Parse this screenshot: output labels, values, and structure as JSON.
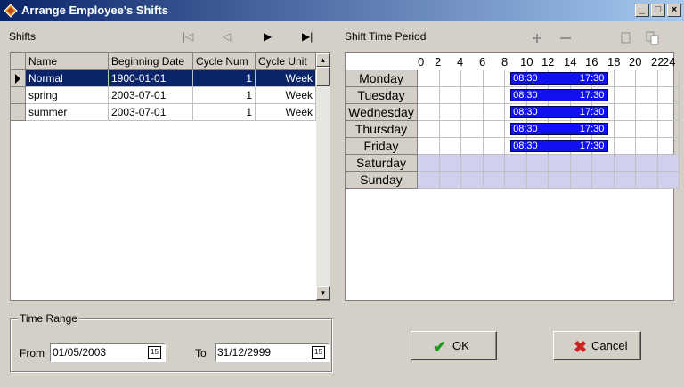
{
  "window": {
    "title": "Arrange Employee's Shifts",
    "controls": [
      "_",
      "□",
      "×"
    ]
  },
  "shifts_panel": {
    "label": "Shifts",
    "nav": [
      {
        "name": "first-record-icon",
        "glyph": "|◁"
      },
      {
        "name": "prev-record-icon",
        "glyph": "◁"
      },
      {
        "name": "next-record-icon",
        "glyph": "▶"
      },
      {
        "name": "last-record-icon",
        "glyph": "▶|"
      }
    ],
    "columns": [
      "Name",
      "Beginning Date",
      "Cycle Num",
      "Cycle Unit"
    ],
    "rows": [
      {
        "name": "Normal",
        "beginning_date": "1900-01-01",
        "cycle_num": "1",
        "cycle_unit": "Week",
        "selected": true
      },
      {
        "name": "spring",
        "beginning_date": "2003-07-01",
        "cycle_num": "1",
        "cycle_unit": "Week",
        "selected": false
      },
      {
        "name": "summer",
        "beginning_date": "2003-07-01",
        "cycle_num": "1",
        "cycle_unit": "Week",
        "selected": false
      }
    ]
  },
  "shift_time_panel": {
    "label": "Shift Time Period",
    "tool_icons": [
      "add-icon",
      "remove-icon",
      "copy-icon",
      "paste-icon"
    ],
    "hour_ticks": [
      "0",
      "2",
      "4",
      "6",
      "8",
      "10",
      "12",
      "14",
      "16",
      "18",
      "20",
      "22",
      "24"
    ],
    "days": [
      {
        "day": "Monday",
        "start": "08:30",
        "end": "17:30",
        "weekend": false
      },
      {
        "day": "Tuesday",
        "start": "08:30",
        "end": "17:30",
        "weekend": false
      },
      {
        "day": "Wednesday",
        "start": "08:30",
        "end": "17:30",
        "weekend": false
      },
      {
        "day": "Thursday",
        "start": "08:30",
        "end": "17:30",
        "weekend": false
      },
      {
        "day": "Friday",
        "start": "08:30",
        "end": "17:30",
        "weekend": false
      },
      {
        "day": "Saturday",
        "start": "",
        "end": "",
        "weekend": true
      },
      {
        "day": "Sunday",
        "start": "",
        "end": "",
        "weekend": true
      }
    ]
  },
  "time_range": {
    "label": "Time Range",
    "from_label": "From",
    "from_value": "01/05/2003",
    "to_label": "To",
    "to_value": "31/12/2999",
    "calendar_glyph": "15"
  },
  "buttons": {
    "ok": "OK",
    "cancel": "Cancel"
  },
  "colors": {
    "title_start": "#0a246a",
    "selection": "#0a246a",
    "shift_bar": "#1010f0",
    "weekend": "#d0d0ee",
    "ok_icon": "#1a9a1a",
    "cancel_icon": "#d02020"
  }
}
